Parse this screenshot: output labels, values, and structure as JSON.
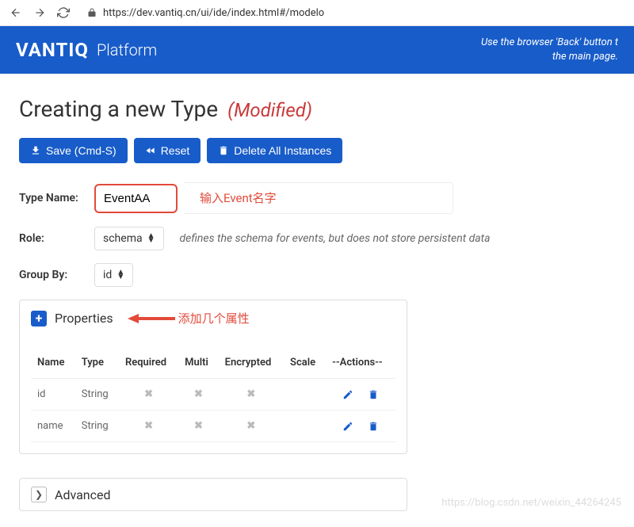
{
  "browser": {
    "url": "https://dev.vantiq.cn/ui/ide/index.html#/modelo"
  },
  "header": {
    "brand": "VANTIQ",
    "platform": "Platform",
    "message_line1": "Use the browser 'Back' button t",
    "message_line2": "the main page."
  },
  "page": {
    "title": "Creating a new Type",
    "modified": "(Modified)"
  },
  "toolbar": {
    "save": "Save (Cmd-S)",
    "reset": "Reset",
    "delete": "Delete All Instances"
  },
  "form": {
    "type_name_label": "Type Name:",
    "type_name_value": "EventAA",
    "type_name_annotation": "输入Event名字",
    "role_label": "Role:",
    "role_value": "schema",
    "role_hint": "defines the schema for events, but does not store persistent data",
    "group_by_label": "Group By:",
    "group_by_value": "id"
  },
  "properties": {
    "title": "Properties",
    "annotation": "添加几个属性",
    "columns": [
      "Name",
      "Type",
      "Required",
      "Multi",
      "Encrypted",
      "Scale",
      "--Actions--"
    ],
    "rows": [
      {
        "name": "id",
        "type": "String",
        "required": false,
        "multi": false,
        "encrypted": false,
        "scale": ""
      },
      {
        "name": "name",
        "type": "String",
        "required": false,
        "multi": false,
        "encrypted": false,
        "scale": ""
      }
    ]
  },
  "advanced": {
    "title": "Advanced"
  },
  "watermark": "https://blog.csdn.net/weixin_44264245"
}
